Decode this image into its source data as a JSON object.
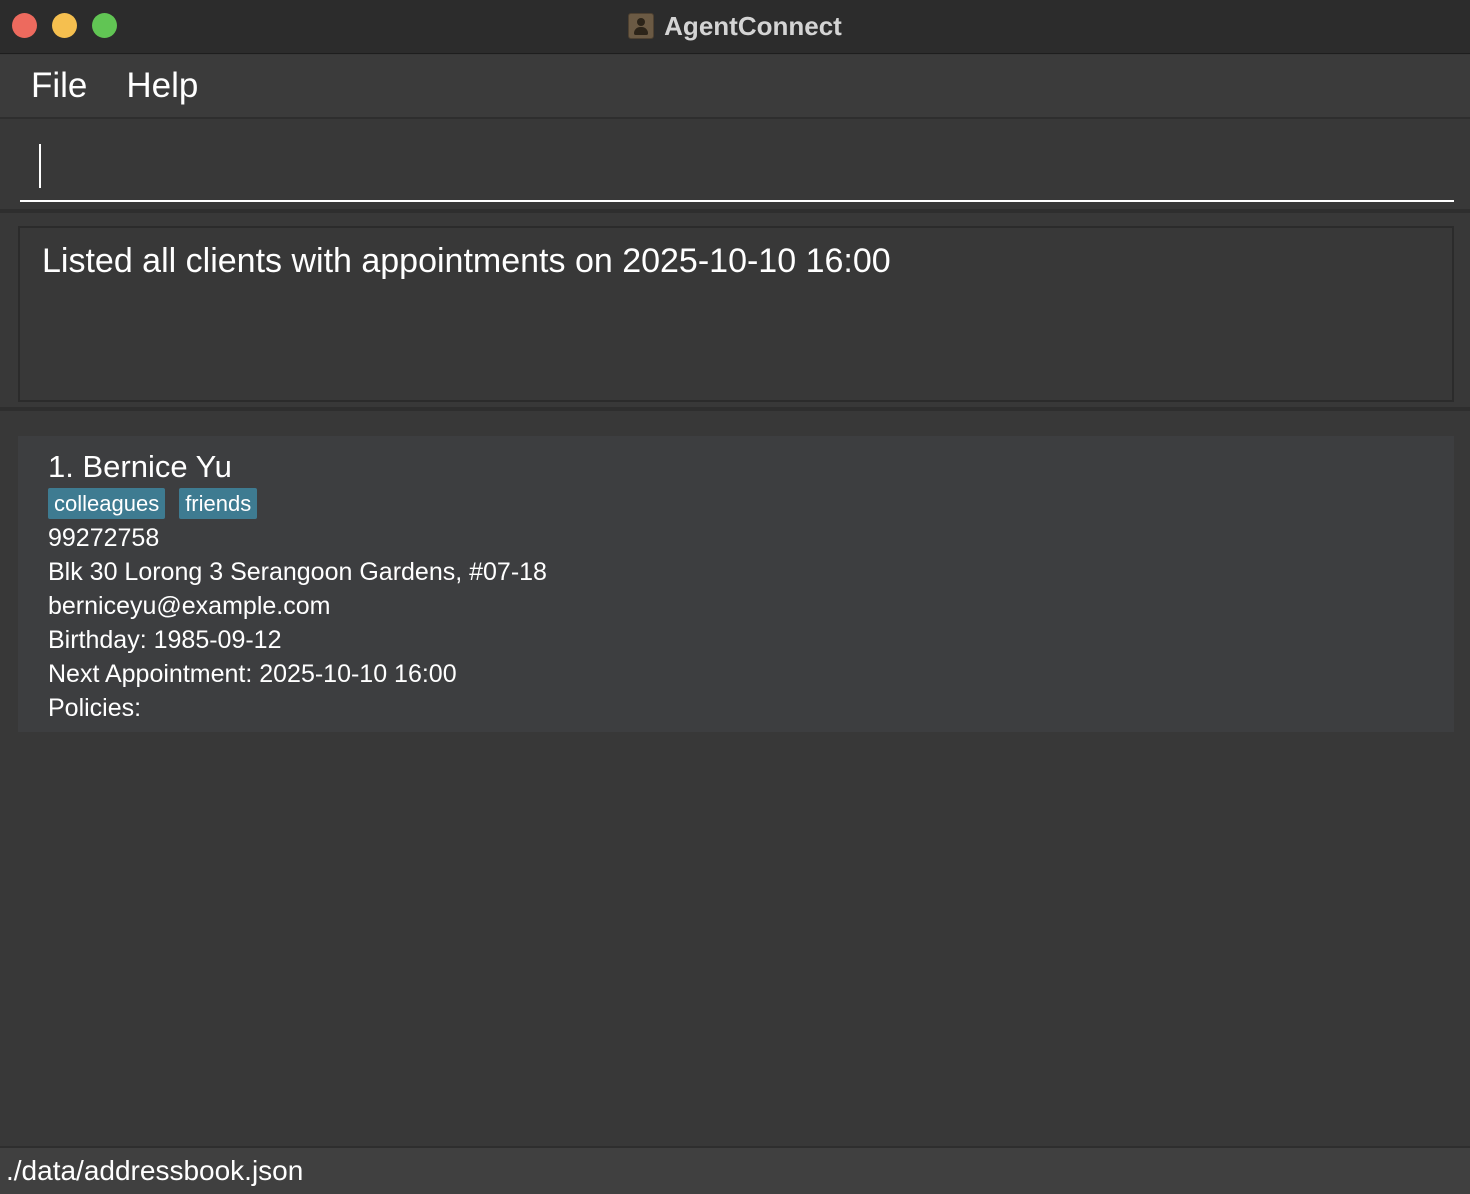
{
  "window": {
    "title": "AgentConnect",
    "app_icon": "contacts-icon"
  },
  "menu": {
    "items": [
      {
        "label": "File"
      },
      {
        "label": "Help"
      }
    ]
  },
  "command": {
    "value": "",
    "placeholder": ""
  },
  "result": {
    "message": "Listed all clients with appointments on 2025-10-10 16:00"
  },
  "clients": [
    {
      "index_name": "1. Bernice Yu",
      "tags": [
        "colleagues",
        "friends"
      ],
      "phone": "99272758",
      "address": "Blk 30 Lorong 3 Serangoon Gardens, #07-18",
      "email": "berniceyu@example.com",
      "birthday": "Birthday: 1985-09-12",
      "next_appointment": "Next Appointment: 2025-10-10 16:00",
      "policies": "Policies:"
    }
  ],
  "status": {
    "file_path": "./data/addressbook.json"
  },
  "colors": {
    "background": "#383838",
    "card": "#3d3e40",
    "tag": "#3e7b91"
  }
}
